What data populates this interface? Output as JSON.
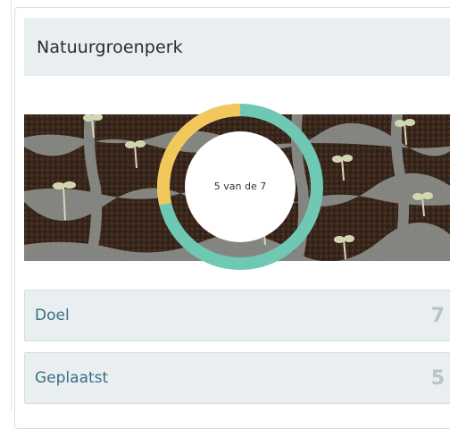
{
  "card": {
    "title": "Natuurgroenperk"
  },
  "progress": {
    "label": "5 van de 7",
    "placed": 5,
    "goal": 7,
    "color_done": "#6fc8b4",
    "color_remaining": "#f2c75c"
  },
  "stats": [
    {
      "label": "Doel",
      "value": "7"
    },
    {
      "label": "Geplaatst",
      "value": "5"
    }
  ],
  "image": {
    "subject": "seedlings-in-tray"
  }
}
